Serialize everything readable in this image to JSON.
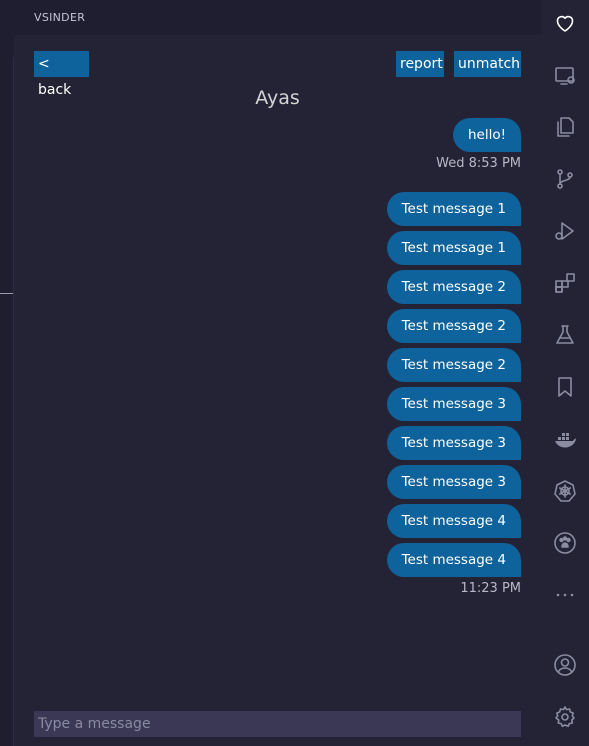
{
  "view": {
    "title": "VSINDER"
  },
  "chat": {
    "back_label": "< back",
    "report_label": "report",
    "unmatch_label": "unmatch",
    "match_name": "Ayas",
    "messages": [
      {
        "text": "hello!"
      },
      {
        "text": "Test message 1"
      },
      {
        "text": "Test message 1"
      },
      {
        "text": "Test message 2"
      },
      {
        "text": "Test message 2"
      },
      {
        "text": "Test message 2"
      },
      {
        "text": "Test message 3"
      },
      {
        "text": "Test message 3"
      },
      {
        "text": "Test message 3"
      },
      {
        "text": "Test message 4"
      },
      {
        "text": "Test message 4"
      }
    ],
    "timestamps": [
      "Wed 8:53 PM",
      "11:23 PM"
    ],
    "composer_placeholder": "Type a message"
  },
  "activity_bar": {
    "icons": [
      "heart-icon",
      "remote-explorer-icon",
      "explorer-icon",
      "source-control-icon",
      "run-debug-icon",
      "extensions-icon",
      "testing-icon",
      "bookmarks-icon",
      "docker-icon",
      "kubernetes-icon",
      "paw-icon",
      "more-icon",
      "account-icon",
      "settings-gear-icon"
    ]
  },
  "colors": {
    "accent": "#0e639c",
    "background": "#242336",
    "header": "#1f1e30",
    "input": "#3a3854"
  }
}
